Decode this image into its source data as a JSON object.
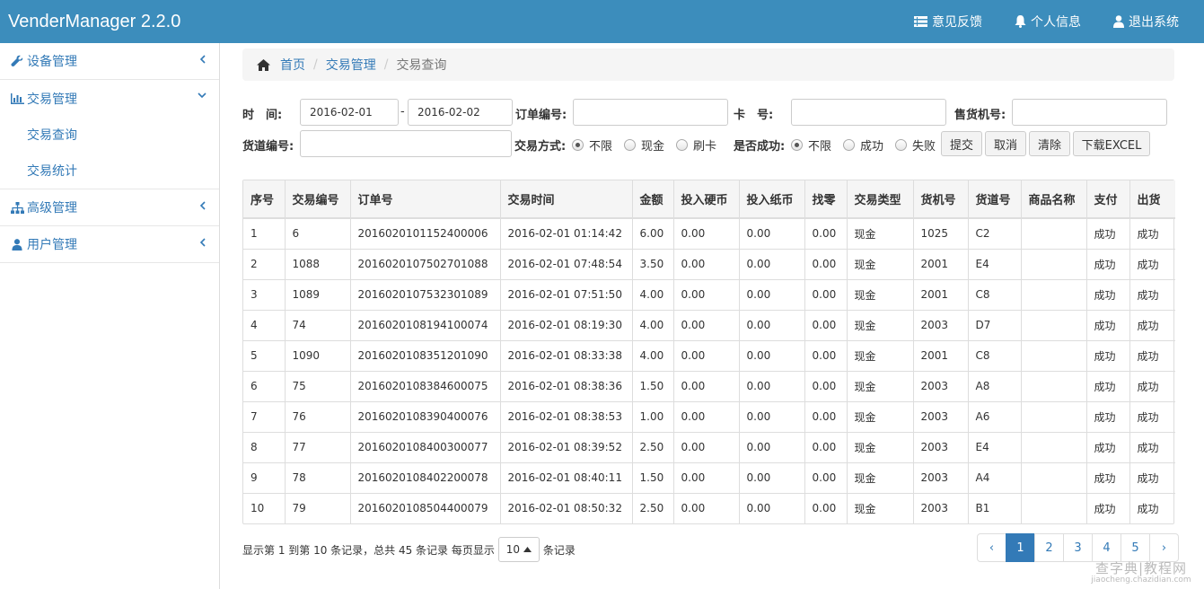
{
  "app": {
    "title": "VenderManager 2.2.0"
  },
  "nav": {
    "feedback": "意见反馈",
    "profile": "个人信息",
    "logout": "退出系统"
  },
  "sidebar": {
    "device": "设备管理",
    "trade": "交易管理",
    "trade_query": "交易查询",
    "trade_stats": "交易统计",
    "advanced": "高级管理",
    "users": "用户管理"
  },
  "breadcrumb": {
    "home": "首页",
    "section": "交易管理",
    "current": "交易查询"
  },
  "filters": {
    "time_label": "时　间:",
    "date_from": "2016-02-01",
    "date_sep": "-",
    "date_to": "2016-02-02",
    "order_label": "订单编号:",
    "order_value": "",
    "card_label": "卡　号:",
    "card_value": "",
    "vender_label": "售货机号:",
    "vender_value": "",
    "lane_label": "货道编号:",
    "lane_value": "",
    "paytype_label": "交易方式:",
    "paytype_options": [
      "不限",
      "现金",
      "刷卡"
    ],
    "paytype_selected": "不限",
    "success_label": "是否成功:",
    "success_options": [
      "不限",
      "成功",
      "失败"
    ],
    "success_selected": "不限",
    "submit": "提交",
    "cancel": "取消",
    "clear": "清除",
    "download": "下载EXCEL"
  },
  "table": {
    "headers": [
      "序号",
      "交易编号",
      "订单号",
      "交易时间",
      "金额",
      "投入硬币",
      "投入纸币",
      "找零",
      "交易类型",
      "货机号",
      "货道号",
      "商品名称",
      "支付",
      "出货"
    ],
    "rows": [
      [
        "1",
        "6",
        "2016020101152400006",
        "2016-02-01 01:14:42",
        "6.00",
        "0.00",
        "0.00",
        "0.00",
        "现金",
        "1025",
        "C2",
        "",
        "成功",
        "成功"
      ],
      [
        "2",
        "1088",
        "2016020107502701088",
        "2016-02-01 07:48:54",
        "3.50",
        "0.00",
        "0.00",
        "0.00",
        "现金",
        "2001",
        "E4",
        "",
        "成功",
        "成功"
      ],
      [
        "3",
        "1089",
        "2016020107532301089",
        "2016-02-01 07:51:50",
        "4.00",
        "0.00",
        "0.00",
        "0.00",
        "现金",
        "2001",
        "C8",
        "",
        "成功",
        "成功"
      ],
      [
        "4",
        "74",
        "2016020108194100074",
        "2016-02-01 08:19:30",
        "4.00",
        "0.00",
        "0.00",
        "0.00",
        "现金",
        "2003",
        "D7",
        "",
        "成功",
        "成功"
      ],
      [
        "5",
        "1090",
        "2016020108351201090",
        "2016-02-01 08:33:38",
        "4.00",
        "0.00",
        "0.00",
        "0.00",
        "现金",
        "2001",
        "C8",
        "",
        "成功",
        "成功"
      ],
      [
        "6",
        "75",
        "2016020108384600075",
        "2016-02-01 08:38:36",
        "1.50",
        "0.00",
        "0.00",
        "0.00",
        "现金",
        "2003",
        "A8",
        "",
        "成功",
        "成功"
      ],
      [
        "7",
        "76",
        "2016020108390400076",
        "2016-02-01 08:38:53",
        "1.00",
        "0.00",
        "0.00",
        "0.00",
        "现金",
        "2003",
        "A6",
        "",
        "成功",
        "成功"
      ],
      [
        "8",
        "77",
        "2016020108400300077",
        "2016-02-01 08:39:52",
        "2.50",
        "0.00",
        "0.00",
        "0.00",
        "现金",
        "2003",
        "E4",
        "",
        "成功",
        "成功"
      ],
      [
        "9",
        "78",
        "2016020108402200078",
        "2016-02-01 08:40:11",
        "1.50",
        "0.00",
        "0.00",
        "0.00",
        "现金",
        "2003",
        "A4",
        "",
        "成功",
        "成功"
      ],
      [
        "10",
        "79",
        "2016020108504400079",
        "2016-02-01 08:50:32",
        "2.50",
        "0.00",
        "0.00",
        "0.00",
        "现金",
        "2003",
        "B1",
        "",
        "成功",
        "成功"
      ]
    ]
  },
  "footer": {
    "info": "显示第 1 到第 10 条记录，总共 45 条记录 每页显示",
    "page_size": "10",
    "suffix": "条记录",
    "pages": [
      "1",
      "2",
      "3",
      "4",
      "5"
    ],
    "active_page": "1",
    "prev": "‹",
    "next": "›"
  },
  "watermark": {
    "line1": "查字典|教程网",
    "line2": "jiaocheng.chazidian.com"
  },
  "colors": {
    "navbar": "#3c8dbc",
    "link": "#337ab7",
    "active_page": "#337ab7"
  }
}
